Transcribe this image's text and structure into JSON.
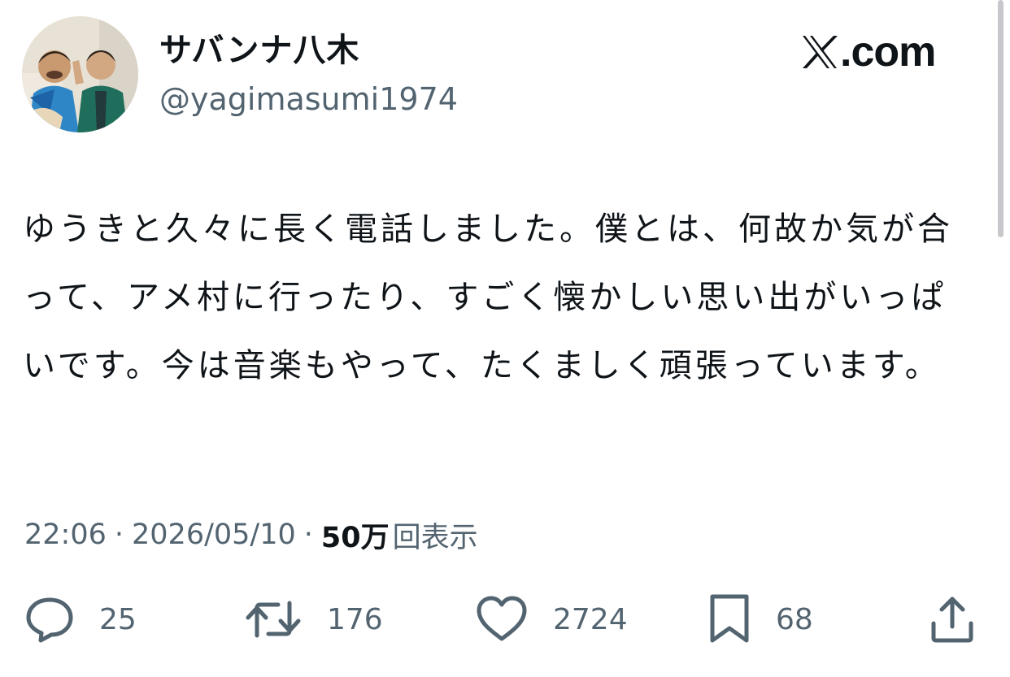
{
  "header": {
    "display_name": "サバンナ八木",
    "handle": "@yagimasumi1974",
    "brand": "X.com"
  },
  "tweet": {
    "text": "ゆうきと久々に長く電話しました。僕とは、何故か気が合って、アメ村に行ったり、すごく懐かしい思い出がいっぱいです。今は音楽もやって、たくましく頑張っています。"
  },
  "meta": {
    "time": "22:06",
    "separator": "·",
    "date": "2026/05/10",
    "views_count": "50万",
    "views_label": "回表示"
  },
  "actions": {
    "replies": "25",
    "reposts": "176",
    "likes": "2724",
    "bookmarks": "68"
  },
  "icons": {
    "avatar": "profile-photo",
    "reply": "speech-bubble-icon",
    "repost": "repost-arrows-icon",
    "like": "heart-icon",
    "bookmark": "bookmark-icon",
    "share": "share-upload-icon"
  },
  "colors": {
    "text": "#0f1419",
    "secondary": "#536471",
    "background": "#ffffff"
  }
}
